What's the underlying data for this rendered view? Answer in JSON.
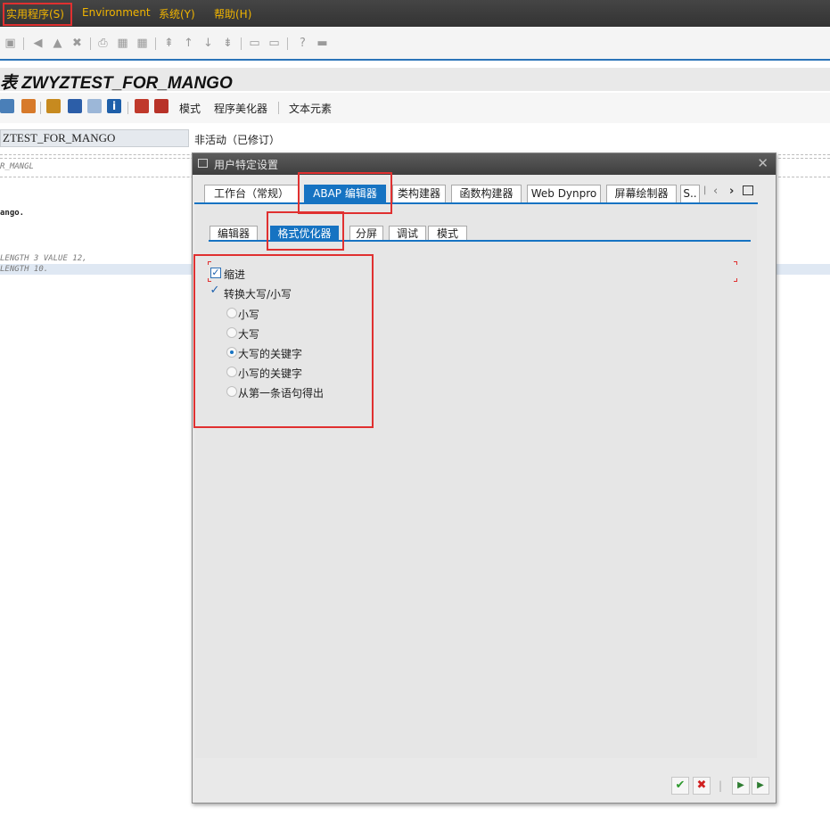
{
  "menu": {
    "items": [
      "实用程序(S)",
      "Environment",
      "系统(Y)",
      "帮助(H)"
    ]
  },
  "title": "表 ZWYZTEST_FOR_MANGO",
  "app_toolbar": {
    "mode_label": "模式",
    "pretty_printer_label": "程序美化器",
    "text_elements_label": "文本元素"
  },
  "program": {
    "name": "ZTEST_FOR_MANGO",
    "status": "非活动（已修订）"
  },
  "code_lines": [
    "R_MANGL",
    "ango.",
    "LENGTH 3 VALUE 12,",
    "LENGTH 10."
  ],
  "dialog": {
    "title": "用户特定设置",
    "tabs": [
      "工作台（常规）",
      "ABAP 编辑器",
      "类构建器",
      "函数构建器",
      "Web Dynpro",
      "屏幕绘制器",
      "S.."
    ],
    "active_tab": "ABAP 编辑器",
    "subtabs": [
      "编辑器",
      "格式优化器",
      "分屏",
      "调试",
      "模式"
    ],
    "active_subtab": "格式优化器",
    "options": {
      "indent": {
        "label": "缩进",
        "checked": true
      },
      "convert_case": {
        "label": "转换大写/小写",
        "checked": true
      },
      "case_options": [
        "小写",
        "大写",
        "大写的关键字",
        "小写的关键字",
        "从第一条语句得出"
      ],
      "selected_case": "大写的关键字"
    },
    "close_symbol": "✕"
  },
  "colors": {
    "accent": "#1673c2",
    "menu_text": "#f0b400",
    "highlight_box": "#e03030"
  }
}
